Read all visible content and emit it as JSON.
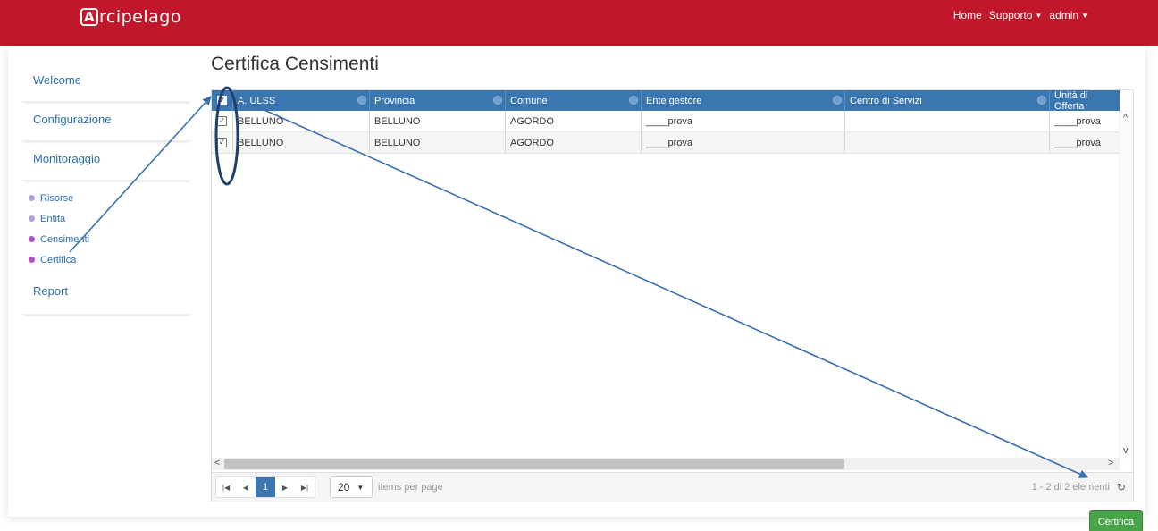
{
  "brand": {
    "logo_letter": "A",
    "logo_text": "rcipelago"
  },
  "topnav": {
    "home": "Home",
    "support": "Supporto",
    "user": "admin"
  },
  "sidebar": {
    "items": [
      {
        "label": "Welcome"
      },
      {
        "label": "Configurazione"
      },
      {
        "label": "Monitoraggio"
      }
    ],
    "subitems": [
      {
        "label": "Risorse"
      },
      {
        "label": "Entità"
      },
      {
        "label": "Censimenti"
      },
      {
        "label": "Certifica",
        "active": true
      }
    ],
    "report": "Report"
  },
  "page": {
    "title": "Certifica Censimenti"
  },
  "grid": {
    "columns": [
      "A. ULSS",
      "Provincia",
      "Comune",
      "Ente gestore",
      "Centro di Servizi",
      "Unità di Offerta"
    ],
    "rows": [
      {
        "checked": true,
        "cells": [
          "BELLUNO",
          "BELLUNO",
          "AGORDO",
          "____prova",
          "",
          "____prova"
        ]
      },
      {
        "checked": true,
        "cells": [
          "BELLUNO",
          "BELLUNO",
          "AGORDO",
          "____prova",
          "",
          "____prova"
        ]
      }
    ]
  },
  "pager": {
    "current_page": "1",
    "page_size": "20",
    "items_per_page": "items per page",
    "info": "1 - 2 di 2 elementi"
  },
  "actions": {
    "certify": "Certifica"
  },
  "colors": {
    "header_red": "#c0172a",
    "grid_header": "#3a77b0",
    "certify_green": "#47a447",
    "annotation": "#3a6fb0"
  }
}
